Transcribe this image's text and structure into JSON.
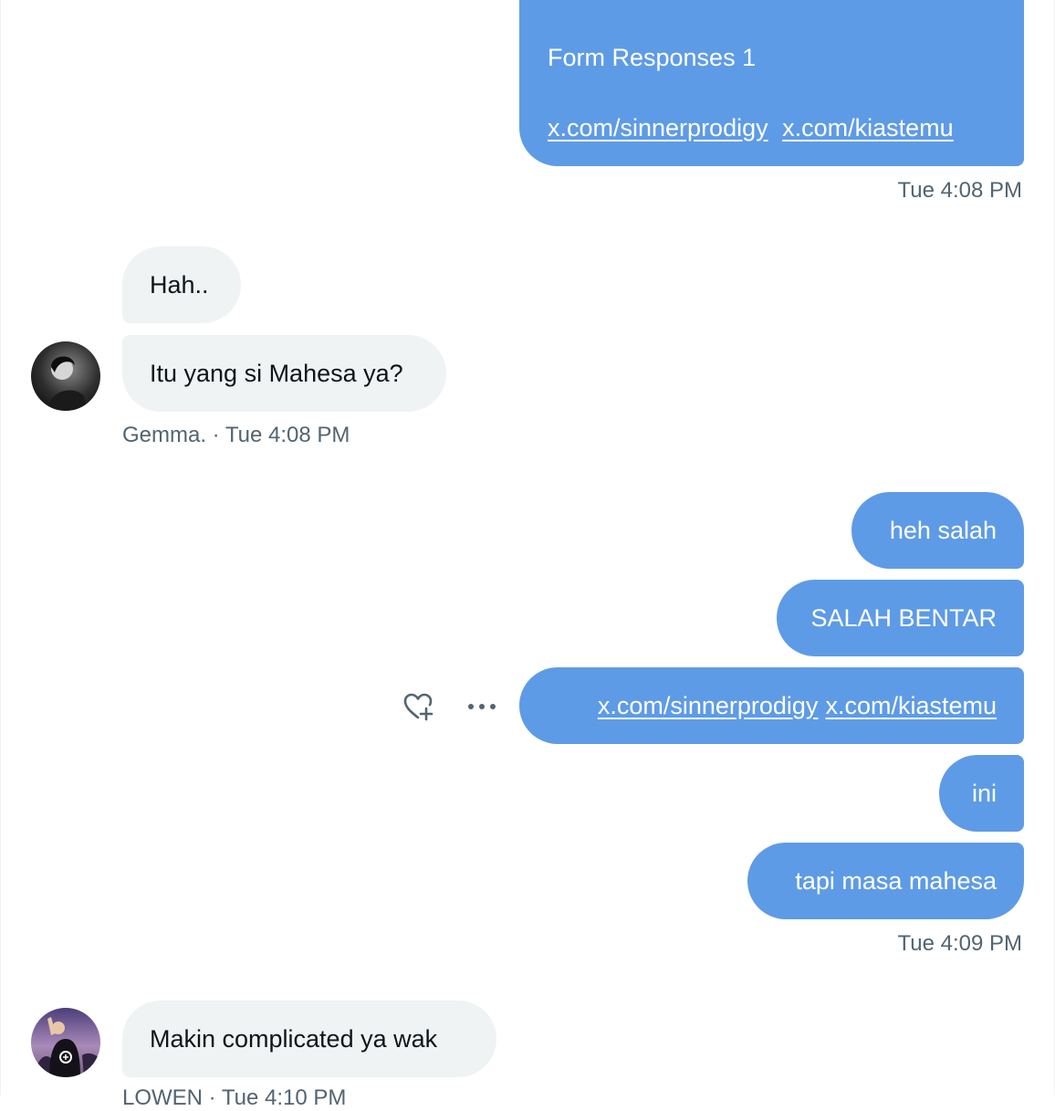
{
  "colors": {
    "outgoing_bubble": "#5e9be6",
    "incoming_bubble": "#eff3f4",
    "meta_text": "#536471"
  },
  "top_message": {
    "line1": "Form Responses 1",
    "links": [
      "x.com/sinnerprodigy",
      "x.com/kiastemu"
    ],
    "timestamp": "Tue 4:08 PM"
  },
  "gemma": {
    "messages": [
      "Hah..",
      "Itu yang si Mahesa ya?"
    ],
    "meta": "Gemma. · Tue 4:08 PM",
    "avatar_icon": "profile-photo"
  },
  "outgoing_group": {
    "messages": {
      "m1": "heh salah",
      "m2": "SALAH BENTAR",
      "m3_links": [
        "x.com/sinnerprodigy",
        "x.com/kiastemu"
      ],
      "m4": "ini",
      "m5": "tapi masa mahesa"
    },
    "timestamp": "Tue 4:09 PM",
    "actions": {
      "react_icon": "heart-plus-icon",
      "more_icon": "more-dots-icon"
    }
  },
  "lowen": {
    "messages": [
      "Makin complicated ya wak"
    ],
    "meta": "LOWEN · Tue 4:10 PM",
    "avatar_icon": "profile-photo"
  }
}
